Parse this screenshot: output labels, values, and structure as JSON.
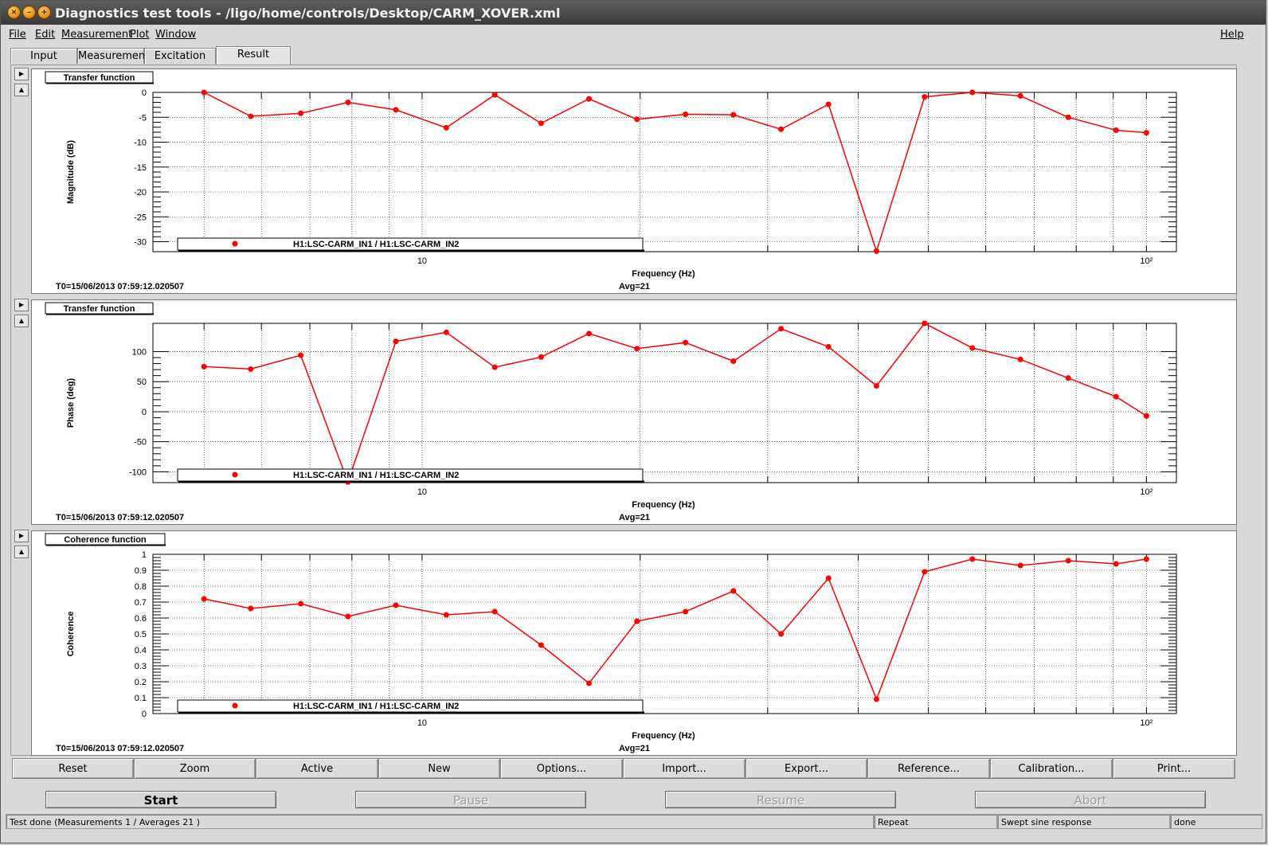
{
  "window": {
    "title": "Diagnostics test tools - /ligo/home/controls/Desktop/CARM_XOVER.xml",
    "buttons": [
      "close",
      "minimize",
      "maximize"
    ]
  },
  "menubar": {
    "items": [
      "File",
      "Edit",
      "Measurement",
      "Plot",
      "Window"
    ],
    "help": "Help"
  },
  "tabs": [
    {
      "label": "Input",
      "active": false
    },
    {
      "label": "Measurement",
      "active": false
    },
    {
      "label": "Excitation",
      "active": false
    },
    {
      "label": "Result",
      "active": true
    }
  ],
  "plots": [
    {
      "pad_title": "Transfer function",
      "t0": "T0=15/06/2013 07:59:12.020507",
      "avg": "Avg=21",
      "legend": "H1:LSC-CARM_IN1 / H1:LSC-CARM_IN2"
    },
    {
      "pad_title": "Transfer function",
      "t0": "T0=15/06/2013 07:59:12.020507",
      "avg": "Avg=21",
      "legend": "H1:LSC-CARM_IN1 / H1:LSC-CARM_IN2"
    },
    {
      "pad_title": "Coherence function",
      "t0": "T0=15/06/2013 07:59:12.020507",
      "avg": "Avg=21",
      "legend": "H1:LSC-CARM_IN1 / H1:LSC-CARM_IN2"
    }
  ],
  "chart_data": [
    {
      "type": "line",
      "xscale": "log",
      "xlabel": "Frequency (Hz)",
      "ylabel": "Magnitude (dB)",
      "xlim": [
        4.25,
        110
      ],
      "ylim": [
        -32,
        0
      ],
      "yticks": [
        0,
        -5,
        -10,
        -15,
        -20,
        -25,
        -30
      ],
      "xtick_labels": [
        {
          "v": 10,
          "t": "10"
        },
        {
          "v": 100,
          "t": "10²"
        }
      ],
      "grid": true,
      "color": "#ff0000",
      "x": [
        5,
        5.8,
        6.8,
        7.9,
        9.2,
        10.8,
        12.6,
        14.6,
        17.0,
        19.8,
        23.1,
        26.9,
        31.3,
        36.4,
        42.4,
        49.4,
        57.5,
        67.0,
        78.0,
        90.8,
        100
      ],
      "y": [
        0,
        -4.8,
        -4.2,
        -2.0,
        -3.5,
        -7.1,
        -0.5,
        -6.2,
        -1.3,
        -5.4,
        -4.4,
        -4.5,
        -7.4,
        -2.4,
        -31.9,
        -0.9,
        0,
        -0.7,
        -5.0,
        -7.6,
        -8.1
      ]
    },
    {
      "type": "line",
      "xscale": "log",
      "xlabel": "Frequency (Hz)",
      "ylabel": "Phase (deg)",
      "xlim": [
        4.25,
        110
      ],
      "ylim": [
        -118,
        147
      ],
      "yticks": [
        100,
        50,
        0,
        -50,
        -100
      ],
      "xtick_labels": [
        {
          "v": 10,
          "t": "10"
        },
        {
          "v": 100,
          "t": "10²"
        }
      ],
      "grid": true,
      "color": "#ff0000",
      "x": [
        5,
        5.8,
        6.8,
        7.9,
        9.2,
        10.8,
        12.6,
        14.6,
        17.0,
        19.8,
        23.1,
        26.9,
        31.3,
        36.4,
        42.4,
        49.4,
        57.5,
        67.0,
        78.0,
        90.8,
        100
      ],
      "y": [
        75,
        71,
        94,
        -117,
        117,
        132,
        74,
        91,
        130,
        105,
        115,
        84,
        138,
        108,
        43,
        147,
        106,
        87,
        56,
        25,
        -7
      ]
    },
    {
      "type": "line",
      "xscale": "log",
      "xlabel": "Frequency (Hz)",
      "ylabel": "Coherence",
      "xlim": [
        4.25,
        110
      ],
      "ylim": [
        0,
        1
      ],
      "yticks": [
        1,
        0.9,
        0.8,
        0.7,
        0.6,
        0.5,
        0.4,
        0.3,
        0.2,
        0.1,
        0
      ],
      "xtick_labels": [
        {
          "v": 10,
          "t": "10"
        },
        {
          "v": 100,
          "t": "10²"
        }
      ],
      "grid": true,
      "color": "#ff0000",
      "x": [
        5,
        5.8,
        6.8,
        7.9,
        9.2,
        10.8,
        12.6,
        14.6,
        17.0,
        19.8,
        23.1,
        26.9,
        31.3,
        36.4,
        42.4,
        49.4,
        57.5,
        67.0,
        78.0,
        90.8,
        100
      ],
      "y": [
        0.72,
        0.66,
        0.69,
        0.61,
        0.68,
        0.62,
        0.64,
        0.43,
        0.19,
        0.58,
        0.64,
        0.77,
        0.5,
        0.85,
        0.09,
        0.89,
        0.97,
        0.93,
        0.96,
        0.94,
        0.97
      ]
    }
  ],
  "plot_buttons": [
    "Reset",
    "Zoom",
    "Active",
    "New",
    "Options...",
    "Import...",
    "Export...",
    "Reference...",
    "Calibration...",
    "Print..."
  ],
  "controls": {
    "start": "Start",
    "pause": "Pause",
    "resume": "Resume",
    "abort": "Abort"
  },
  "status": {
    "message": "Test done (Measurements 1 / Averages 21 )",
    "repeat": "Repeat",
    "type": "Swept sine response",
    "state": "done"
  }
}
